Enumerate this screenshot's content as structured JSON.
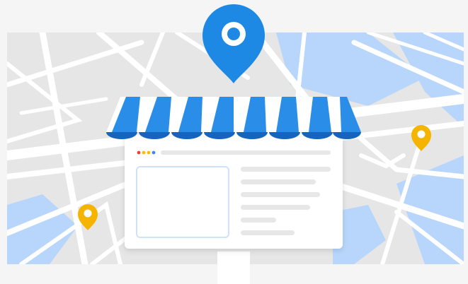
{
  "illustration": {
    "colors": {
      "background": "#f5f5f5",
      "map_land": "#e6e6e6",
      "map_water": "#b8d6fb",
      "roads": "#ffffff",
      "pin_main": "#1e88e5",
      "pin_accent": "#f5b400",
      "awning_blue": "#2a8ee8",
      "awning_blue_dark": "#1565c0",
      "awning_white": "#ffffff",
      "card": "#ffffff",
      "card_border": "#e3e3e3",
      "placeholder_lines": "#e7e7e7",
      "thumbnail_border": "#b8d6fb",
      "dot_red": "#ea4335",
      "dot_yellow": "#fbbc04",
      "dot_blue": "#4285f4"
    },
    "icons": [
      "map-pin-icon",
      "map-pin-icon",
      "map-pin-icon",
      "storefront-awning-icon",
      "browser-dots-icon"
    ]
  }
}
